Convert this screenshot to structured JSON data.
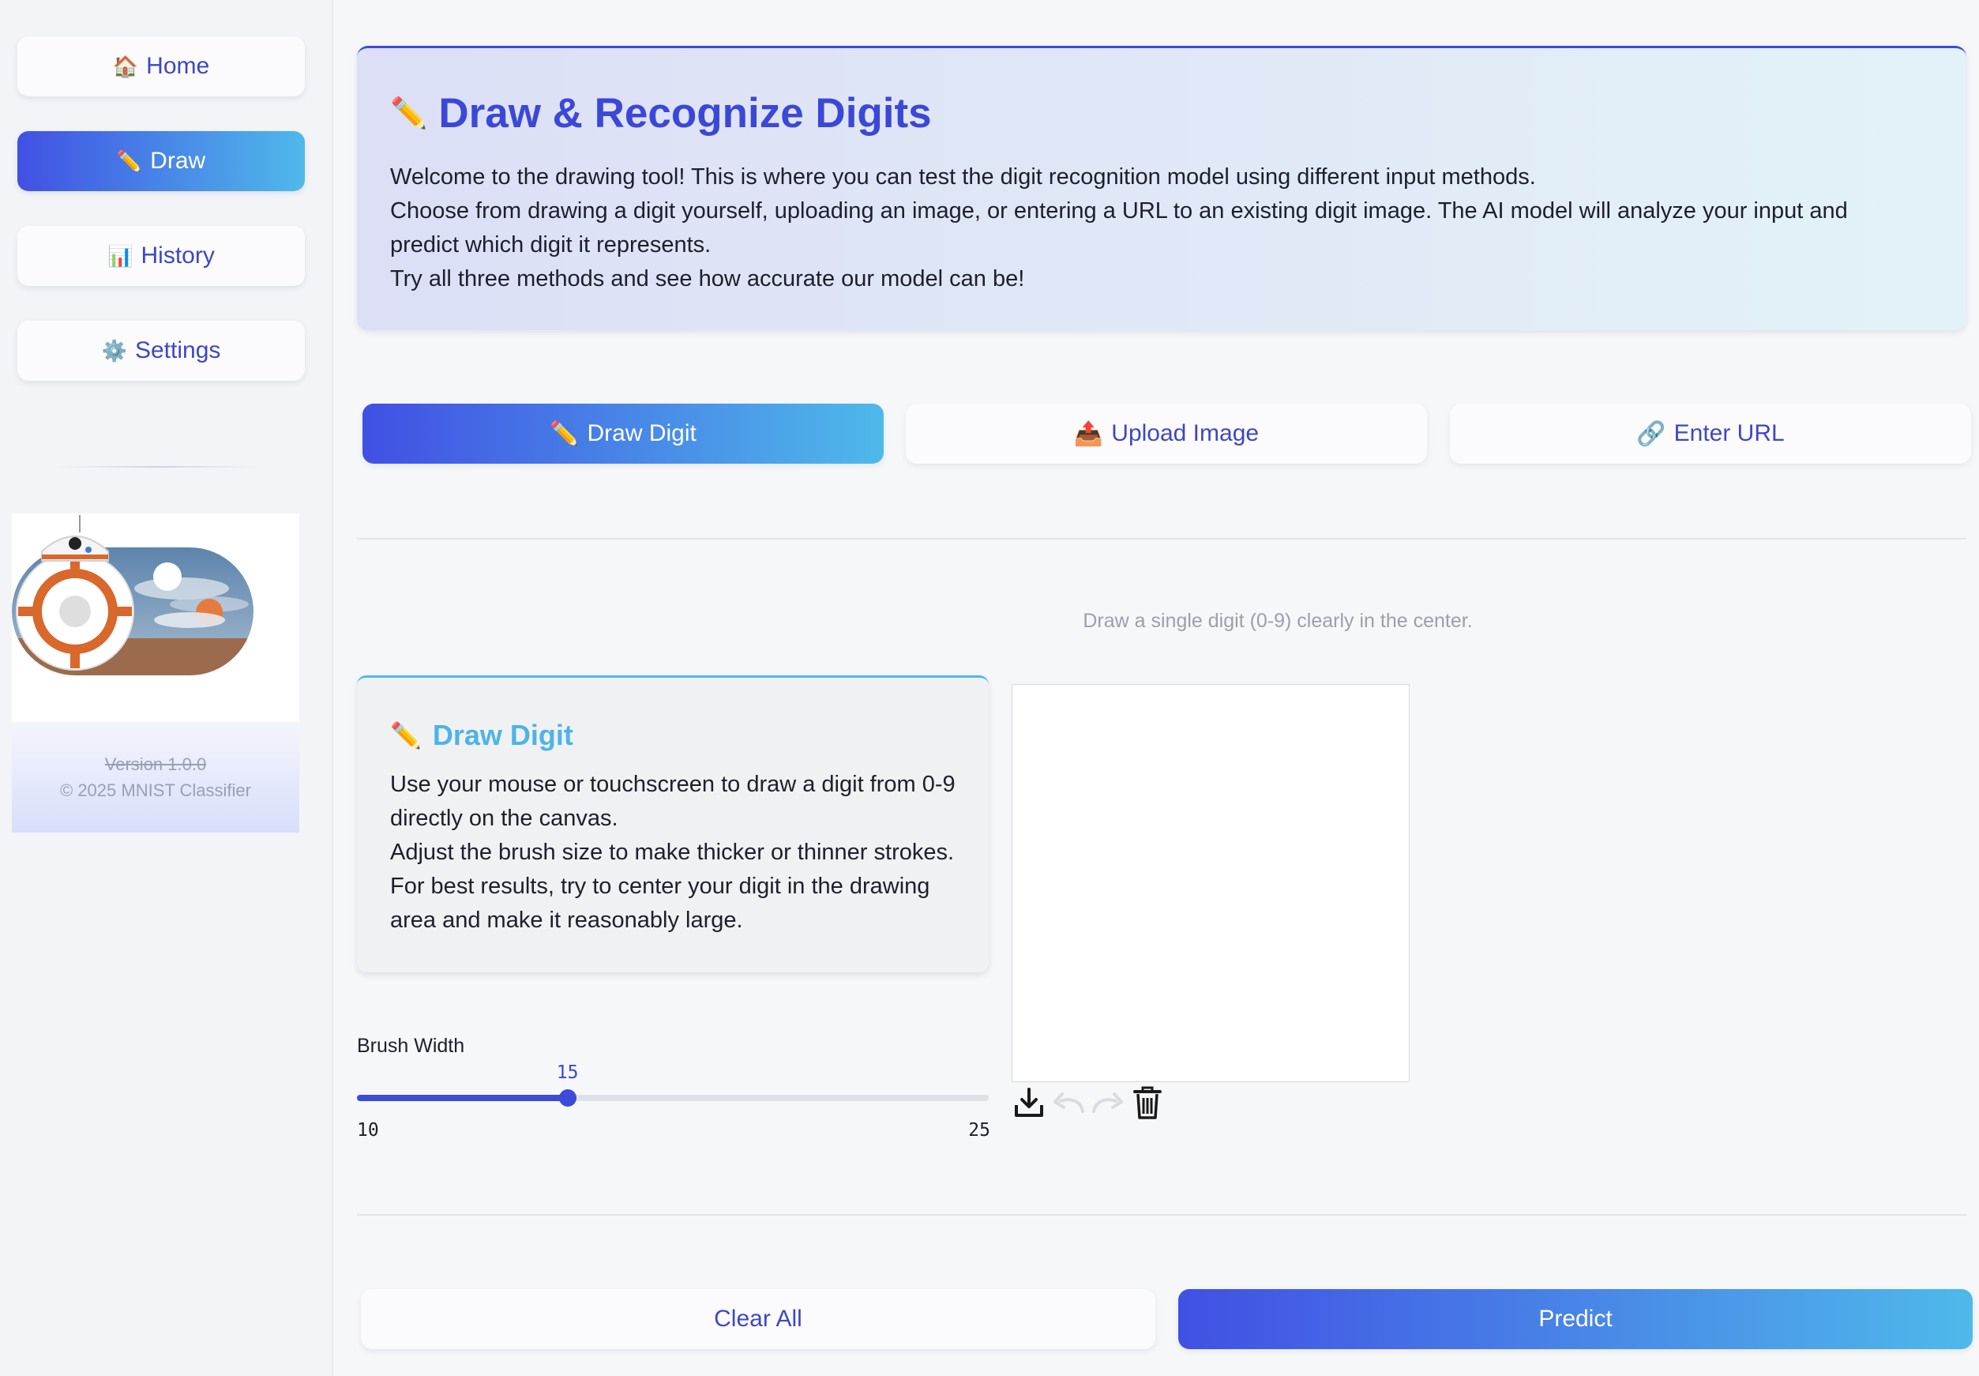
{
  "sidebar": {
    "items": [
      {
        "icon": "🏠",
        "label": "Home"
      },
      {
        "icon": "✏️",
        "label": "Draw"
      },
      {
        "icon": "📊",
        "label": "History"
      },
      {
        "icon": "⚙️",
        "label": "Settings"
      }
    ],
    "version": "Version 1.0.0",
    "copyright": "© 2025 MNIST Classifier"
  },
  "header": {
    "icon": "✏️",
    "title": "Draw & Recognize Digits",
    "lines": [
      "Welcome to the drawing tool! This is where you can test the digit recognition model using different input methods.",
      "Choose from drawing a digit yourself, uploading an image, or entering a URL to an existing digit image. The AI model will analyze your input and predict which digit it represents.",
      "Try all three methods and see how accurate our model can be!"
    ]
  },
  "tabs": [
    {
      "icon": "✏️",
      "label": "Draw Digit"
    },
    {
      "icon": "📤",
      "label": "Upload Image"
    },
    {
      "icon": "🔗",
      "label": "Enter URL"
    }
  ],
  "hint": "Draw a single digit (0-9) clearly in the center.",
  "card": {
    "icon": "✏️",
    "title": "Draw Digit",
    "lines": [
      "Use your mouse or touchscreen to draw a digit from 0-9 directly on the canvas.",
      "Adjust the brush size to make thicker or thinner strokes. For best results, try to center your digit in the drawing area and make it reasonably large."
    ]
  },
  "brush": {
    "label": "Brush Width",
    "value": 15,
    "min": 10,
    "max": 25
  },
  "canvas_tools": [
    "download-icon",
    "undo-icon",
    "redo-icon",
    "trash-icon"
  ],
  "actions": {
    "clear": "Clear All",
    "predict": "Predict"
  },
  "colors": {
    "accent": "#3e4ad8",
    "gradient_end": "#4fb9ea"
  }
}
